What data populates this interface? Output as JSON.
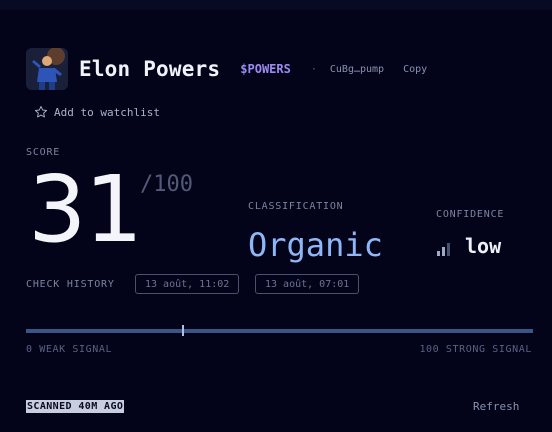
{
  "token": {
    "name": "Elon Powers",
    "ticker": "$POWERS",
    "separator": "·",
    "address_short": "CuBg…pump",
    "copy_label": "Copy"
  },
  "watchlist": {
    "label": "Add to watchlist",
    "icon": "star-outline-icon"
  },
  "score": {
    "label": "SCORE",
    "value": "31",
    "max": "/100",
    "fraction": 0.31
  },
  "classification": {
    "label": "CLASSIFICATION",
    "value": "Organic"
  },
  "confidence": {
    "label": "CONFIDENCE",
    "value": "low",
    "bars_filled": 2,
    "bars_total": 3
  },
  "check_history": {
    "label": "CHECK HISTORY",
    "entries": [
      "13 août, 11:02",
      "13 août, 07:01"
    ]
  },
  "signal_scale": {
    "left_label": "0 WEAK SIGNAL",
    "right_label": "100 STRONG SIGNAL"
  },
  "footer": {
    "scanned": "SCANNED 40M AGO",
    "refresh_label": "Refresh"
  },
  "colors": {
    "background": "#03041a",
    "ticker": "#9c8cf0",
    "classification": "#8fb7f7",
    "track": "#3b5585",
    "marker": "#a9c0ea"
  }
}
